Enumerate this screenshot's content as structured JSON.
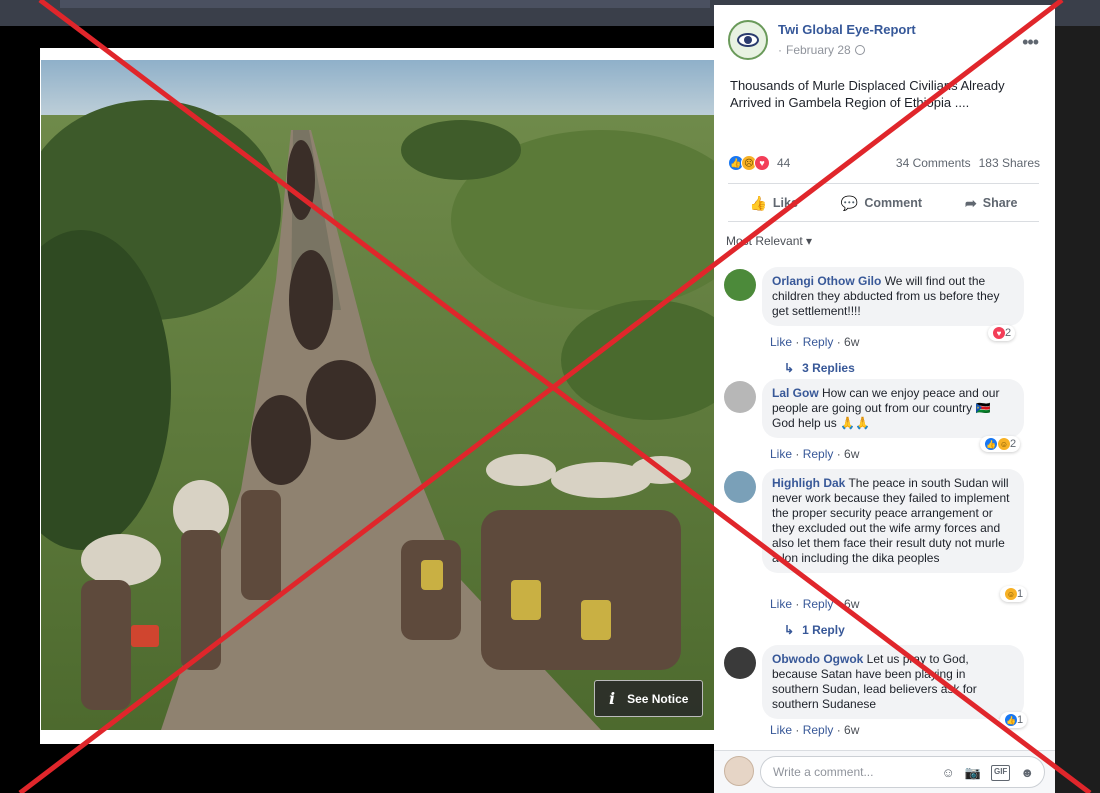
{
  "post": {
    "page_name": "Twi Global Eye-Report",
    "date": "February 28",
    "date_prefix": "·",
    "text": "Thousands of Murle Displaced Civilians Already Arrived in Gambela Region of Ethiopia ....",
    "reaction_count": "44",
    "comments_count": "34 Comments",
    "shares_count": "183 Shares"
  },
  "actions": {
    "like": "Like",
    "comment": "Comment",
    "share": "Share"
  },
  "filter_label": "Most Relevant ▾",
  "comments": [
    {
      "author": "Orlangi Othow Gilo",
      "text": "We will find out the children they abducted from us before they get settlement!!!!",
      "like": "Like",
      "reply": "Reply",
      "age": "6w",
      "reactions": "2",
      "replies": "3 Replies"
    },
    {
      "author": "Lal Gow",
      "text": "How can we enjoy peace and our people are going out from our country 🇸🇸 God help us 🙏🙏",
      "like": "Like",
      "reply": "Reply",
      "age": "6w",
      "reactions": "2"
    },
    {
      "author": "Highligh Dak",
      "text": "The peace in south Sudan will never work because they failed to implement the proper security peace arrangement or they excluded out the wife army forces and also let them face their result duty not murle a lon including the dika peoples",
      "like": "Like",
      "reply": "Reply",
      "age": "6w",
      "reactions": "1",
      "replies": "1 Reply"
    },
    {
      "author": "Obwodo Ogwok",
      "text": "Let us pray to God, because Satan have been playing in southern Sudan, lead believers ask for southern Sudanese",
      "like": "Like",
      "reply": "Reply",
      "age": "6w",
      "reactions": "1"
    }
  ],
  "composer": {
    "placeholder": "Write a comment..."
  },
  "photo": {
    "notice_label": "See Notice"
  },
  "colors": {
    "accent_link": "#365899",
    "cross_red": "#e0262b"
  }
}
